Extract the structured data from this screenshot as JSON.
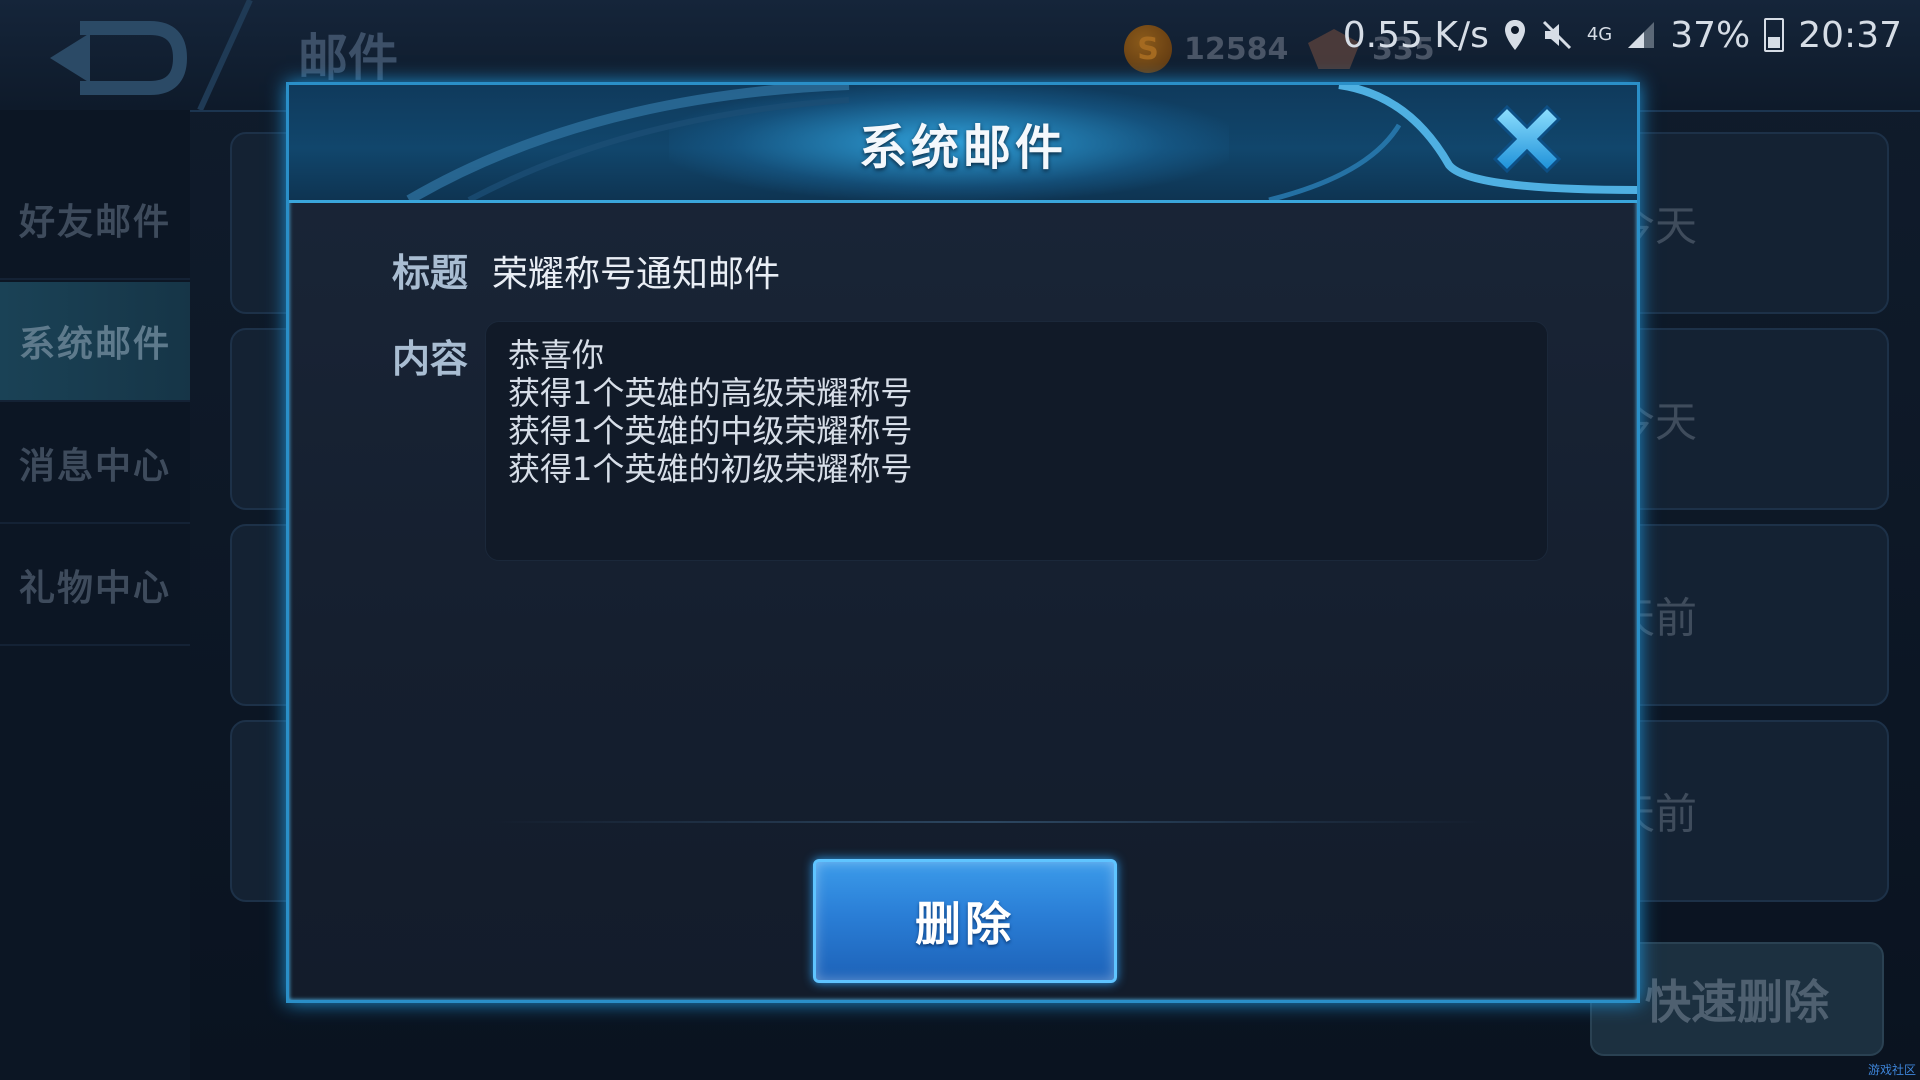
{
  "screen": {
    "title": "邮件",
    "resources": {
      "gold": "12584",
      "diamonds": "335"
    },
    "status_bar": {
      "speed": "0.55 K/s",
      "network": "4G",
      "battery": "37%",
      "time": "20:37"
    },
    "sidebar": [
      {
        "label": "好友邮件",
        "active": false
      },
      {
        "label": "系统邮件",
        "active": true
      },
      {
        "label": "消息中心",
        "active": false
      },
      {
        "label": "礼物中心",
        "active": false
      }
    ],
    "mail_times": [
      "今天",
      "今天",
      "天前",
      "天前"
    ],
    "quick_delete_label": "快速删除",
    "watermark": "游戏社区"
  },
  "modal": {
    "title": "系统邮件",
    "subject_label": "标题",
    "subject": "荣耀称号通知邮件",
    "content_label": "内容",
    "content_lines": [
      "恭喜你",
      "获得1个英雄的高级荣耀称号",
      "获得1个英雄的中级荣耀称号",
      "获得1个英雄的初级荣耀称号"
    ],
    "delete_label": "删除"
  },
  "colors": {
    "accent": "#2a8fc8",
    "button": "#2a7ed6",
    "close": "#3fb8ff"
  }
}
